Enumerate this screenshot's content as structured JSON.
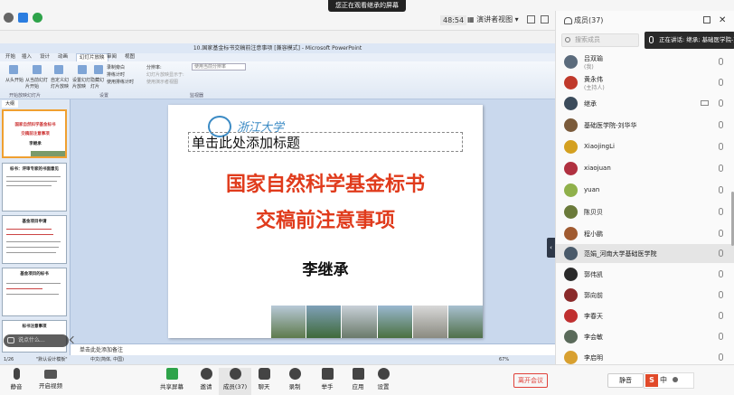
{
  "topbar": {
    "share_banner": "您正在观看继承的屏幕",
    "timer": "48:54",
    "view_label": "演讲者视图"
  },
  "ppt": {
    "window_title": "10.国家基金标书交稿前注意事项 [兼容模式] - Microsoft PowerPoint",
    "tabs": [
      "开始",
      "插入",
      "设计",
      "动画",
      "幻灯片放映",
      "审阅",
      "视图"
    ],
    "active_tab_index": 4,
    "ribbon": {
      "from_start": "从头开始",
      "from_current": "从当前幻灯片开始",
      "custom": "自定义幻灯片放映",
      "setup": "设置幻灯片放映",
      "hide": "隐藏幻灯片",
      "record": "录制旁白",
      "rehearse": "排练计时",
      "use_timing": "使用排练计时",
      "resolution": "分辨率:",
      "resolution_value": "使用当前分辨率",
      "show_on": "幻灯片放映显示于:",
      "presenter_view": "使用演示者视图",
      "group_start": "开始放映幻灯片",
      "group_setup": "设置",
      "group_monitor": "监视器"
    },
    "thumbs_tab": "大纲",
    "thumbnails": [
      {
        "title1": "国家自然科学基金标书",
        "title2": "交稿前注意事项",
        "author": "李继承"
      },
      {
        "title1": "标书：评审专家的书面意见"
      },
      {
        "title1": "基金项目申请"
      },
      {
        "title1": "基金项目的标书"
      },
      {
        "title1": "标书注意事项"
      }
    ],
    "slide": {
      "logo_text": "浙江大学",
      "title_placeholder": "单击此处添加标题",
      "main_title": "国家自然科学基金标书",
      "sub_title": "交稿前注意事项",
      "author": "李继承"
    },
    "notes_placeholder": "单击此处添加备注",
    "status": {
      "slide_count": "1/26",
      "theme": "\"默认设计模板\"",
      "language": "中文(简体, 中国)",
      "zoom": "67%"
    },
    "comment_placeholder": "说点什么..."
  },
  "panel": {
    "title": "成员(37)",
    "search_placeholder": "搜索成员",
    "speaking": "正在讲话: 继承; 基础医学院-刘...",
    "members": [
      {
        "name": "吕双瑜",
        "role": "(我)",
        "color": "#5b6b7c"
      },
      {
        "name": "黄永伟",
        "role": "(主持人)",
        "color": "#c0392b"
      },
      {
        "name": "继承",
        "role": "",
        "color": "#3b4b5b"
      },
      {
        "name": "基础医学院-刘华华",
        "role": "",
        "color": "#7a5a3a"
      },
      {
        "name": "XiaojingLi",
        "role": "",
        "color": "#d4a020"
      },
      {
        "name": "xiaojuan",
        "role": "",
        "color": "#b03040"
      },
      {
        "name": "yuan",
        "role": "",
        "color": "#8fb04a"
      },
      {
        "name": "陈贝贝",
        "role": "",
        "color": "#6a7a3a"
      },
      {
        "name": "程小鹏",
        "role": "",
        "color": "#a05a30"
      },
      {
        "name": "范娟_河南大学基础医学院",
        "role": "",
        "color": "#4a5a6a"
      },
      {
        "name": "郭伟凯",
        "role": "",
        "color": "#2a2a2a"
      },
      {
        "name": "郭向前",
        "role": "",
        "color": "#8a2a2a"
      },
      {
        "name": "李春天",
        "role": "",
        "color": "#c03030"
      },
      {
        "name": "李会敏",
        "role": "",
        "color": "#5a6a5a"
      },
      {
        "name": "李启明",
        "role": "",
        "color": "#d8a030"
      }
    ]
  },
  "bottombar": {
    "mute": "静音",
    "video": "开启视频",
    "share": "共享屏幕",
    "invite": "邀请",
    "members": "成员(37)",
    "chat": "聊天",
    "record": "录制",
    "raise_hand": "举手",
    "apps": "应用",
    "settings": "设置",
    "leave": "离开会议",
    "mute_all": "静音",
    "ime_label": "中"
  }
}
